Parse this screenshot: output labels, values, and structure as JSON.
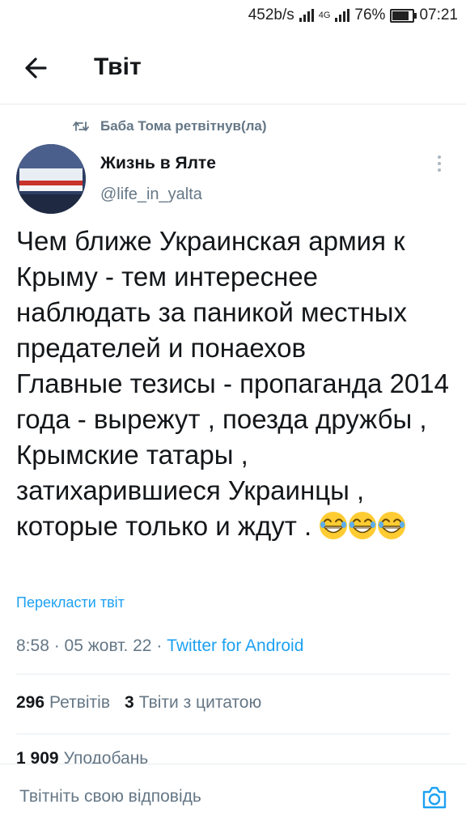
{
  "status_bar": {
    "speed": "452b/s",
    "network": "4G",
    "battery": "76%",
    "time": "07:21"
  },
  "header": {
    "title": "Твіт"
  },
  "retweet": {
    "text": "Баба Тома ретвітнув(ла)"
  },
  "author": {
    "name": "Жизнь в Ялте",
    "handle": "@life_in_yalta"
  },
  "tweet": {
    "text": "Чем ближе Украинская армия к Крыму - тем интереснее наблюдать за паникой местных предателей и понаехов\nГлавные тезисы - пропаганда 2014 года - вырежут , поезда дружбы , Крымские татары , затихарившиеся Украинцы , которые только и ждут . ",
    "translate_label": "Перекласти твіт",
    "time": "8:58",
    "date": "05 жовт. 22",
    "source": "Twitter for Android"
  },
  "stats": {
    "retweets_count": "296",
    "retweets_label": "Ретвітів",
    "quotes_count": "3",
    "quotes_label": "Твіти з цитатою",
    "likes_count": "1 909",
    "likes_label": "Уподобань"
  },
  "reply": {
    "placeholder": "Твітніть свою відповідь"
  },
  "colors": {
    "accent": "#1da1f2",
    "secondary_text": "#657786",
    "divider": "#e6ecf0"
  }
}
